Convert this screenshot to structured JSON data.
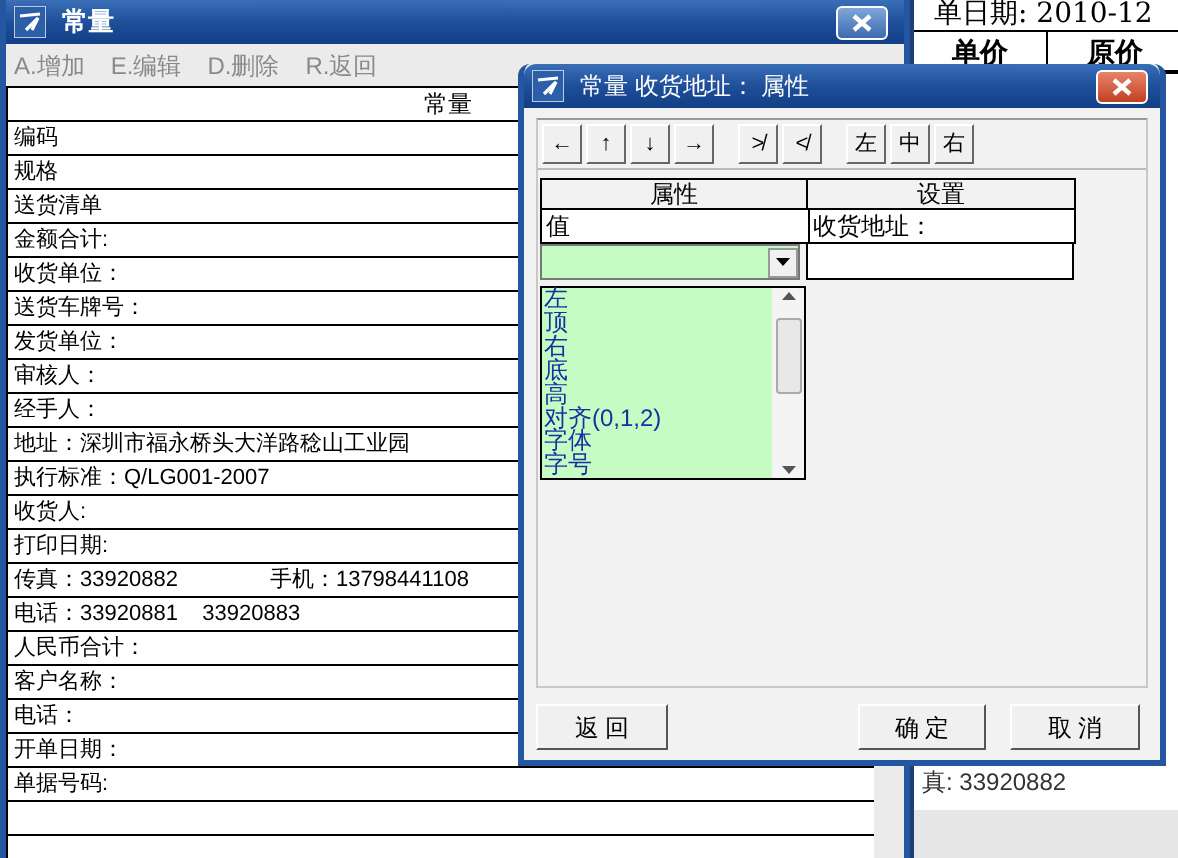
{
  "background_document": {
    "date_text": "单日期: 2010-12",
    "columns": [
      "单价",
      "原价"
    ],
    "fax_text": "真: 33920882"
  },
  "main_window": {
    "title": "常量",
    "menu": [
      "A.增加",
      "E.编辑",
      "D.删除",
      "R.返回"
    ],
    "table_header": "常量",
    "rows": [
      {
        "cells": [
          "编码"
        ]
      },
      {
        "cells": [
          "规格"
        ]
      },
      {
        "cells": [
          "送货清单"
        ]
      },
      {
        "cells": [
          "金额合计:"
        ]
      },
      {
        "cells": [
          "收货单位："
        ]
      },
      {
        "cells": [
          "送货车牌号："
        ]
      },
      {
        "cells": [
          "发货单位："
        ]
      },
      {
        "cells": [
          "审核人："
        ]
      },
      {
        "cells": [
          "经手人："
        ]
      },
      {
        "cells": [
          "地址：深圳市福永桥头大洋路稔山工业园"
        ]
      },
      {
        "cells": [
          "执行标准：Q/LG001-2007"
        ]
      },
      {
        "cells": [
          "收货人:"
        ]
      },
      {
        "cells": [
          "打印日期:"
        ]
      },
      {
        "cells": [
          "传真：33920882",
          "手机：13798441108"
        ]
      },
      {
        "cells": [
          "电话：33920881    33920883"
        ]
      },
      {
        "cells": [
          "人民币合计："
        ]
      },
      {
        "cells": [
          "客户名称："
        ]
      },
      {
        "cells": [
          "电话："
        ]
      },
      {
        "cells": [
          "开单日期："
        ]
      },
      {
        "cells": [
          "单据号码:"
        ]
      },
      {
        "cells": []
      },
      {
        "cells": []
      }
    ]
  },
  "dialog": {
    "title": "常量 收货地址： 属性",
    "toolbar": [
      "←",
      "↑",
      "↓",
      "→",
      "≯",
      "≮",
      "左",
      "中",
      "右"
    ],
    "grid": {
      "columns": [
        "属性",
        "设置"
      ],
      "value_label": "值",
      "value_setting": "收货地址："
    },
    "list_items": [
      "左",
      "顶",
      "右",
      "底",
      "高",
      "对齐(0,1,2)",
      "字体",
      "字号"
    ],
    "buttons": {
      "back": "返 回",
      "ok": "确 定",
      "cancel": "取 消"
    }
  }
}
